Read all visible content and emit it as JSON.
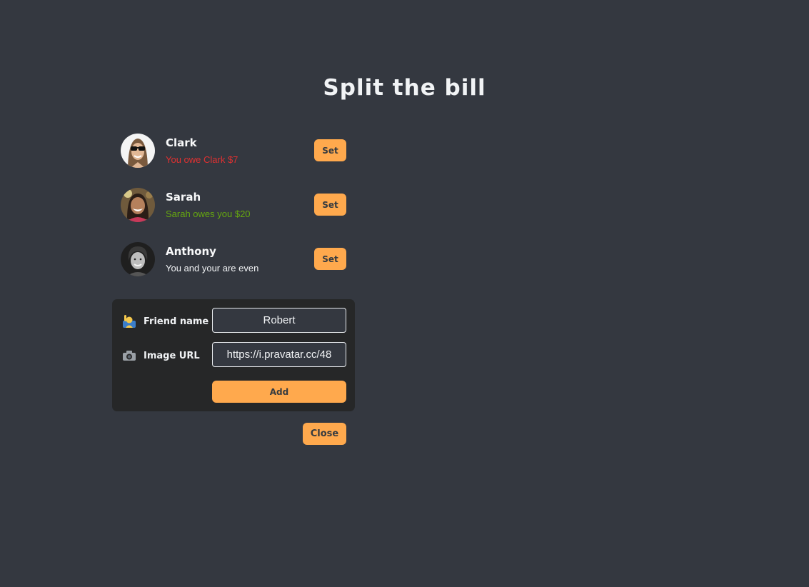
{
  "header": {
    "title": "Split the bill"
  },
  "friends": [
    {
      "name": "Clark",
      "status": "You owe Clark $7",
      "status_type": "owe",
      "set_label": "Set",
      "avatar": "clark-avatar"
    },
    {
      "name": "Sarah",
      "status": "Sarah owes you $20",
      "status_type": "owed",
      "set_label": "Set",
      "avatar": "sarah-avatar"
    },
    {
      "name": "Anthony",
      "status": "You and your are even",
      "status_type": "even",
      "set_label": "Set",
      "avatar": "anthony-avatar"
    }
  ],
  "add_form": {
    "name_icon": "person-raising-hand-icon",
    "name_label": "Friend name",
    "name_value": "Robert",
    "image_icon": "camera-icon",
    "image_label": "Image URL",
    "image_value": "https://i.pravatar.cc/48",
    "add_label": "Add"
  },
  "close_label": "Close",
  "colors": {
    "background": "#343840",
    "form_background": "#262728",
    "accent": "#ffa94d",
    "owe": "#e03131",
    "owed": "#66a80f",
    "text": "#f1f3f5"
  }
}
